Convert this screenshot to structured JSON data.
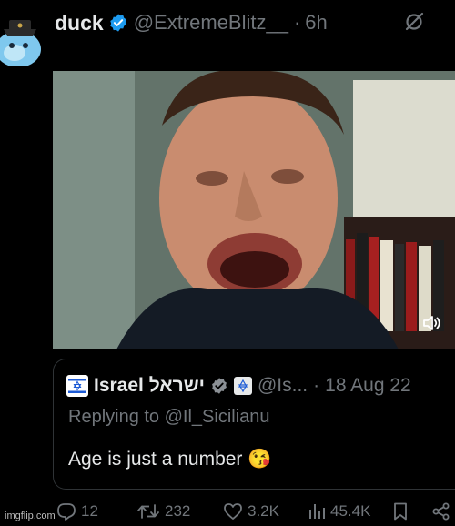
{
  "post": {
    "author_name": "duck",
    "handle": "@ExtremeBlitz__",
    "separator": "·",
    "time": "6h",
    "media": {
      "sound_icon": "volume-icon"
    },
    "quote": {
      "author_name": "Israel ישראל",
      "handle": "@Is...",
      "separator": "·",
      "date": "18 Aug 22",
      "replying_to": "Replying to @Il_Sicilianu",
      "text": "Age is just a number 😘"
    },
    "actions": {
      "replies": "12",
      "reposts": "232",
      "likes": "3.2K",
      "views": "45.4K"
    }
  },
  "watermark": "imgflip.com",
  "colors": {
    "background": "#000000",
    "verified": "#1d9bf0",
    "muted": "#71767b",
    "text": "#e7e9ea"
  }
}
